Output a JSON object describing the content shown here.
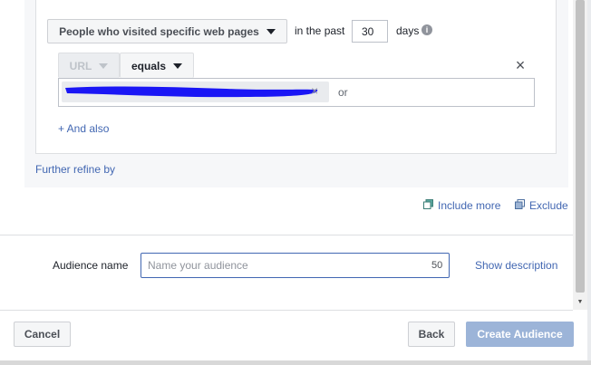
{
  "rule": {
    "visitor_type": "People who visited specific web pages",
    "in_the_past": "in the past",
    "days_value": "30",
    "days_label": "days",
    "info_glyph": "i",
    "url_field_label": "URL",
    "operator": "equals",
    "remove_glyph": "×",
    "token_remove_glyph": "×",
    "or_label": "or",
    "and_also": "+ And also"
  },
  "further_refine": "Further refine by",
  "actions": {
    "include_more": "Include more",
    "exclude": "Exclude"
  },
  "audience": {
    "label": "Audience name",
    "placeholder": "Name your audience",
    "value": "",
    "char_count": "50",
    "show_description": "Show description"
  },
  "footer": {
    "cancel": "Cancel",
    "back": "Back",
    "create": "Create Audience"
  },
  "colors": {
    "link": "#4267b2",
    "primary_disabled": "#9cb4d8",
    "redaction": "#1a16f5"
  }
}
